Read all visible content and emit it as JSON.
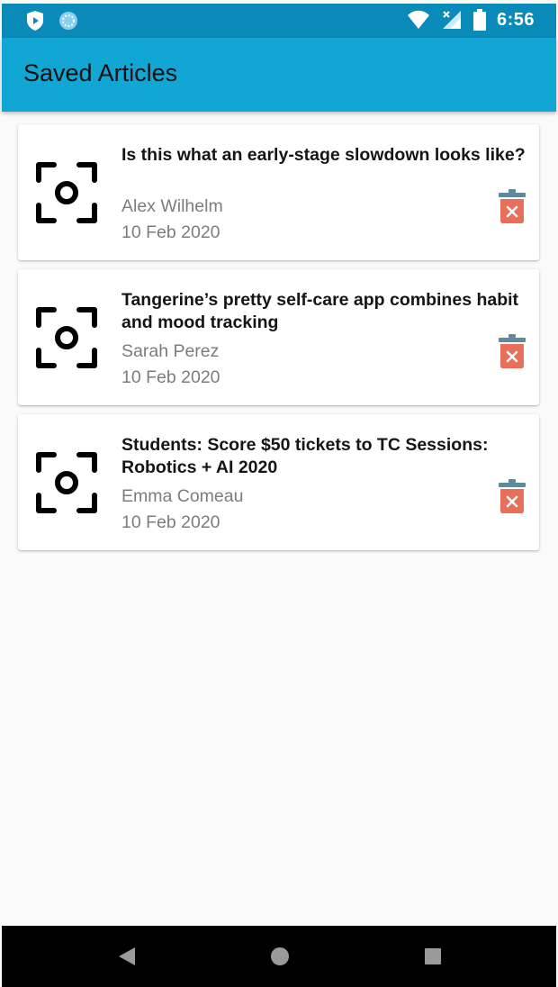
{
  "status_bar": {
    "time": "6:56",
    "icons_left": [
      "shield-play-icon",
      "sync-circle-icon"
    ],
    "icons_right": [
      "wifi-icon",
      "signal-no-data-icon",
      "battery-icon"
    ]
  },
  "app_bar": {
    "title": "Saved Articles"
  },
  "articles": [
    {
      "title": "Is this what an early-stage slowdown looks like?",
      "author": "Alex Wilhelm",
      "date": "10 Feb 2020",
      "thumbnail_icon": "camera-focus-icon",
      "action_icon": "delete-icon"
    },
    {
      "title": "Tangerine’s pretty self-care app combines habit and mood tracking",
      "author": "Sarah Perez",
      "date": "10 Feb 2020",
      "thumbnail_icon": "camera-focus-icon",
      "action_icon": "delete-icon"
    },
    {
      "title": "Students: Score $50 tickets to TC Sessions: Robotics + AI 2020",
      "author": "Emma Comeau",
      "date": "10 Feb 2020",
      "thumbnail_icon": "camera-focus-icon",
      "action_icon": "delete-icon"
    }
  ],
  "nav_bar": {
    "icons": [
      "back-icon",
      "home-icon",
      "recents-icon"
    ]
  },
  "colors": {
    "status_bar": "#0a8ab8",
    "app_bar": "#12a6d4",
    "delete_red": "#e8705a",
    "delete_lid": "#5f8a9a"
  }
}
